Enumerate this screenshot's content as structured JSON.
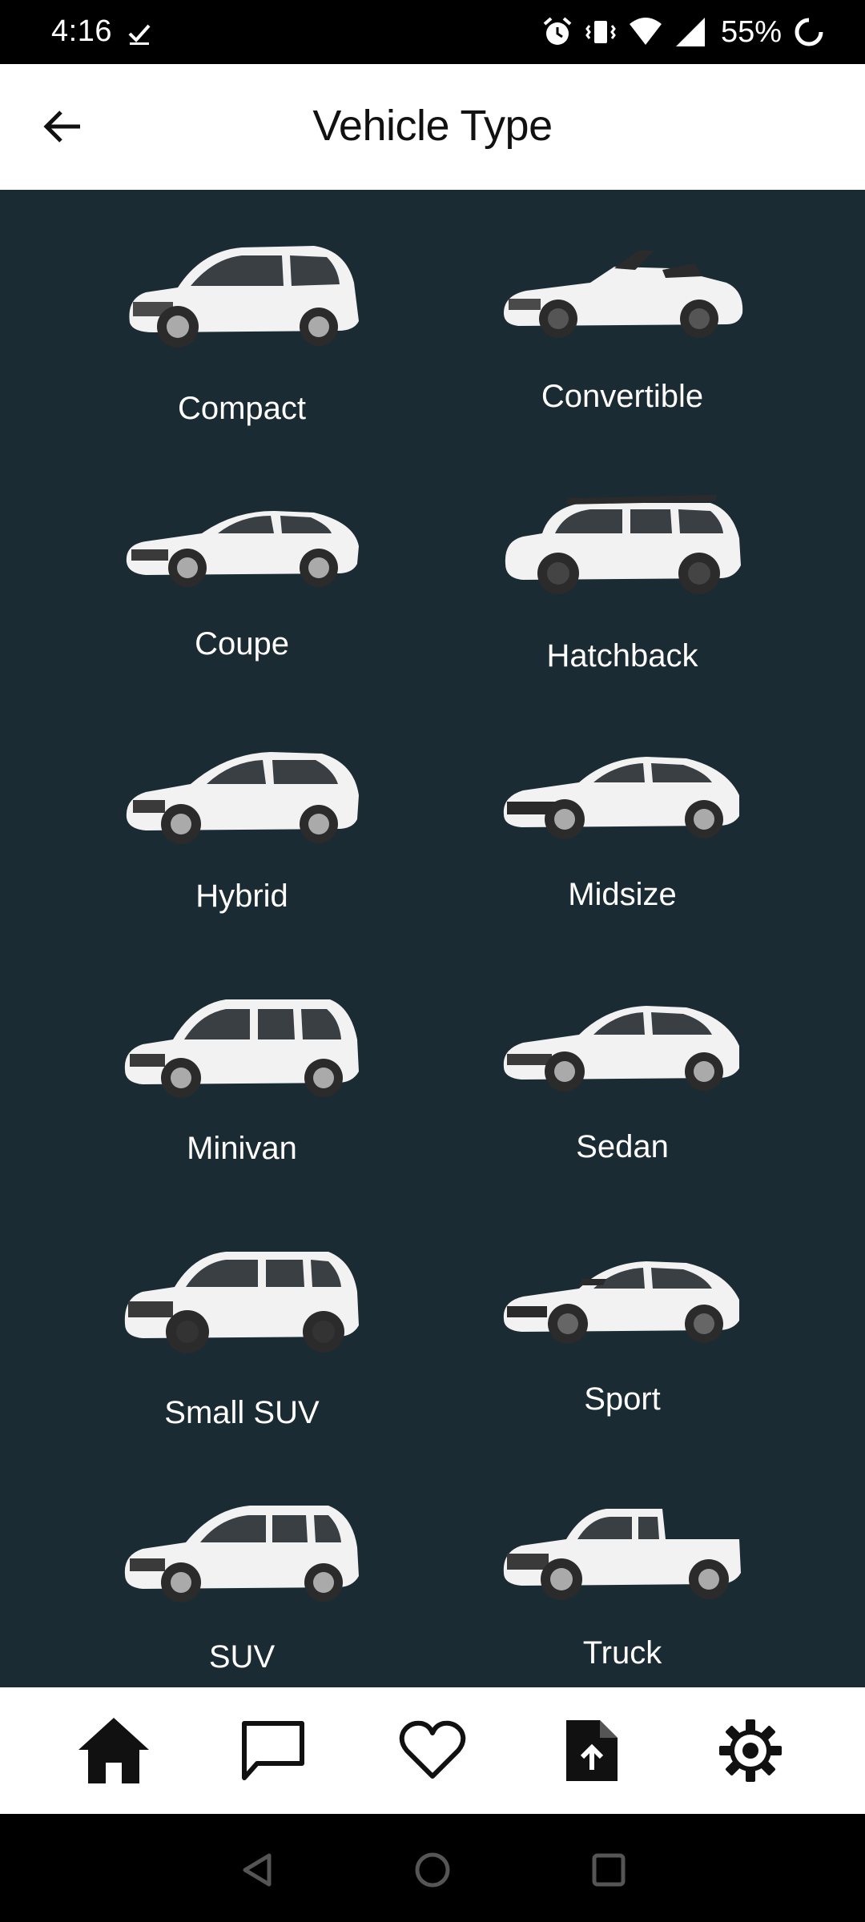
{
  "status_bar": {
    "time": "4:16",
    "battery_percent": "55%",
    "icons": [
      "download-check-icon",
      "alarm-icon",
      "vibrate-icon",
      "wifi-icon",
      "signal-icon",
      "battery-icon"
    ]
  },
  "header": {
    "title": "Vehicle Type",
    "back_icon": "arrow-left-icon"
  },
  "vehicle_types": [
    {
      "label": "Compact"
    },
    {
      "label": "Convertible"
    },
    {
      "label": "Coupe"
    },
    {
      "label": "Hatchback"
    },
    {
      "label": "Hybrid"
    },
    {
      "label": "Midsize"
    },
    {
      "label": "Minivan"
    },
    {
      "label": "Sedan"
    },
    {
      "label": "Small SUV"
    },
    {
      "label": "Sport"
    },
    {
      "label": "SUV"
    },
    {
      "label": "Truck"
    }
  ],
  "bottom_nav": {
    "items": [
      "home-icon",
      "chat-icon",
      "heart-icon",
      "upload-file-icon",
      "settings-icon"
    ]
  },
  "system_nav": {
    "items": [
      "back-triangle-icon",
      "home-circle-icon",
      "recents-square-icon"
    ]
  },
  "colors": {
    "grid_background": "#1b2b33",
    "header_background": "#ffffff",
    "label_text": "#ffffff"
  }
}
